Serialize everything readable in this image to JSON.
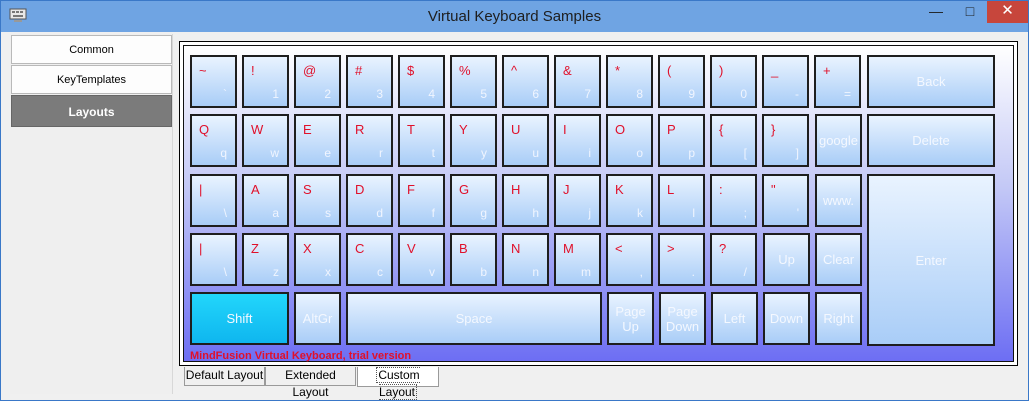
{
  "window": {
    "title": "Virtual Keyboard Samples",
    "minimize_glyph": "—",
    "maximize_glyph": "□",
    "close_glyph": "✕"
  },
  "sidebar": {
    "items": [
      {
        "label": "Common"
      },
      {
        "label": "KeyTemplates"
      },
      {
        "label": "Layouts"
      }
    ]
  },
  "keyboard": {
    "number_row": [
      {
        "shift": "~",
        "base": "`"
      },
      {
        "shift": "!",
        "base": "1"
      },
      {
        "shift": "@",
        "base": "2"
      },
      {
        "shift": "#",
        "base": "3"
      },
      {
        "shift": "$",
        "base": "4"
      },
      {
        "shift": "%",
        "base": "5"
      },
      {
        "shift": "^",
        "base": "6"
      },
      {
        "shift": "&",
        "base": "7"
      },
      {
        "shift": "*",
        "base": "8"
      },
      {
        "shift": "(",
        "base": "9"
      },
      {
        "shift": ")",
        "base": "0"
      },
      {
        "shift": "_",
        "base": "-"
      },
      {
        "shift": "+",
        "base": "="
      }
    ],
    "top_row": [
      {
        "shift": "Q",
        "base": "q"
      },
      {
        "shift": "W",
        "base": "w"
      },
      {
        "shift": "E",
        "base": "e"
      },
      {
        "shift": "R",
        "base": "r"
      },
      {
        "shift": "T",
        "base": "t"
      },
      {
        "shift": "Y",
        "base": "y"
      },
      {
        "shift": "U",
        "base": "u"
      },
      {
        "shift": "I",
        "base": "i"
      },
      {
        "shift": "O",
        "base": "o"
      },
      {
        "shift": "P",
        "base": "p"
      },
      {
        "shift": "{",
        "base": "["
      },
      {
        "shift": "}",
        "base": "]"
      }
    ],
    "home_row": [
      {
        "shift": "|",
        "base": "\\"
      },
      {
        "shift": "A",
        "base": "a"
      },
      {
        "shift": "S",
        "base": "s"
      },
      {
        "shift": "D",
        "base": "d"
      },
      {
        "shift": "F",
        "base": "f"
      },
      {
        "shift": "G",
        "base": "g"
      },
      {
        "shift": "H",
        "base": "h"
      },
      {
        "shift": "J",
        "base": "j"
      },
      {
        "shift": "K",
        "base": "k"
      },
      {
        "shift": "L",
        "base": "l"
      },
      {
        "shift": ":",
        "base": ";"
      },
      {
        "shift": "\"",
        "base": "'"
      }
    ],
    "bottom_row": [
      {
        "shift": "|",
        "base": "\\"
      },
      {
        "shift": "Z",
        "base": "z"
      },
      {
        "shift": "X",
        "base": "x"
      },
      {
        "shift": "C",
        "base": "c"
      },
      {
        "shift": "V",
        "base": "v"
      },
      {
        "shift": "B",
        "base": "b"
      },
      {
        "shift": "N",
        "base": "n"
      },
      {
        "shift": "M",
        "base": "m"
      },
      {
        "shift": "<",
        "base": ","
      },
      {
        "shift": ">",
        "base": "."
      },
      {
        "shift": "?",
        "base": "/"
      }
    ],
    "special": {
      "back": "Back",
      "delete": "Delete",
      "enter": "Enter",
      "google": "google",
      "www": "www.",
      "up": "Up",
      "clear": "Clear",
      "shift": "Shift",
      "altgr": "AltGr",
      "space": "Space",
      "page_up": "Page\nUp",
      "page_down": "Page\nDown",
      "left": "Left",
      "down": "Down",
      "right": "Right"
    },
    "trial_notice": "MindFusion Virtual Keyboard, trial version"
  },
  "tabs": [
    {
      "label": "Default Layout"
    },
    {
      "label": "Extended Layout"
    },
    {
      "label": "Custom Layout"
    }
  ],
  "colors": {
    "titlebar": "#6fa4e3",
    "close_button": "#c7463c",
    "shift_label": "#e0102a",
    "shift_key": "#22d6fb",
    "sidebar_selected": "#7b7b7b"
  }
}
